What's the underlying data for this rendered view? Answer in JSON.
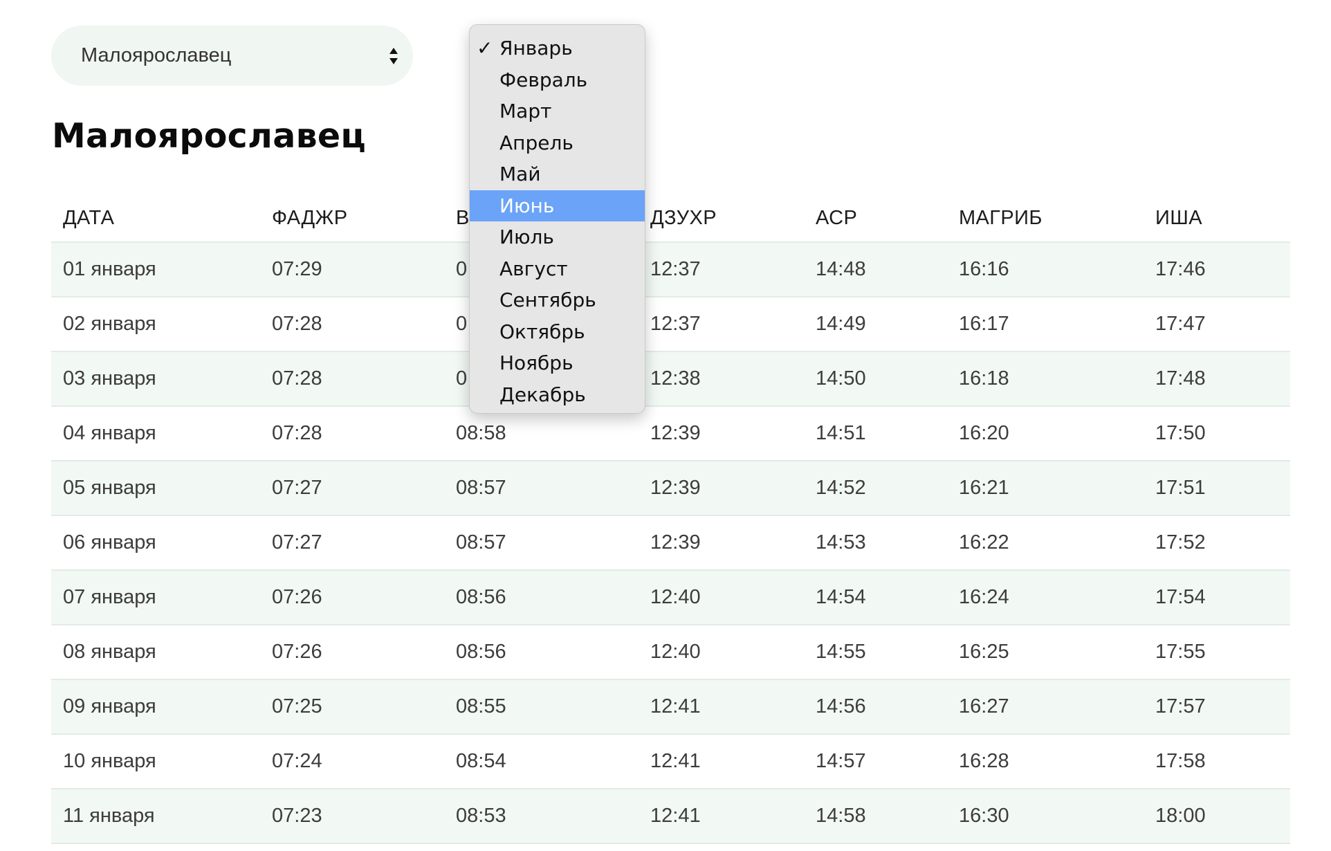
{
  "city_select": {
    "value": "Малоярославец",
    "icon": "up-down-arrows-icon"
  },
  "title": "Малоярославец",
  "table": {
    "headers": [
      "ДАТА",
      "ФАДЖР",
      "В",
      "ДЗУХР",
      "АСР",
      "МАГРИБ",
      "ИША"
    ],
    "rows": [
      [
        "01 января",
        "07:29",
        "0",
        "12:37",
        "14:48",
        "16:16",
        "17:46"
      ],
      [
        "02 января",
        "07:28",
        "0",
        "12:37",
        "14:49",
        "16:17",
        "17:47"
      ],
      [
        "03 января",
        "07:28",
        "0",
        "12:38",
        "14:50",
        "16:18",
        "17:48"
      ],
      [
        "04 января",
        "07:28",
        "08:58",
        "12:39",
        "14:51",
        "16:20",
        "17:50"
      ],
      [
        "05 января",
        "07:27",
        "08:57",
        "12:39",
        "14:52",
        "16:21",
        "17:51"
      ],
      [
        "06 января",
        "07:27",
        "08:57",
        "12:39",
        "14:53",
        "16:22",
        "17:52"
      ],
      [
        "07 января",
        "07:26",
        "08:56",
        "12:40",
        "14:54",
        "16:24",
        "17:54"
      ],
      [
        "08 января",
        "07:26",
        "08:56",
        "12:40",
        "14:55",
        "16:25",
        "17:55"
      ],
      [
        "09 января",
        "07:25",
        "08:55",
        "12:41",
        "14:56",
        "16:27",
        "17:57"
      ],
      [
        "10 января",
        "07:24",
        "08:54",
        "12:41",
        "14:57",
        "16:28",
        "17:58"
      ],
      [
        "11 января",
        "07:23",
        "08:53",
        "12:41",
        "14:58",
        "16:30",
        "18:00"
      ]
    ]
  },
  "month_menu": {
    "check_mark": "✓",
    "selected_index": 0,
    "highlighted_index": 5,
    "highlight_color": "#6aa3f7",
    "items": [
      "Январь",
      "Февраль",
      "Март",
      "Апрель",
      "Май",
      "Июнь",
      "Июль",
      "Август",
      "Сентябрь",
      "Октябрь",
      "Ноябрь",
      "Декабрь"
    ]
  }
}
